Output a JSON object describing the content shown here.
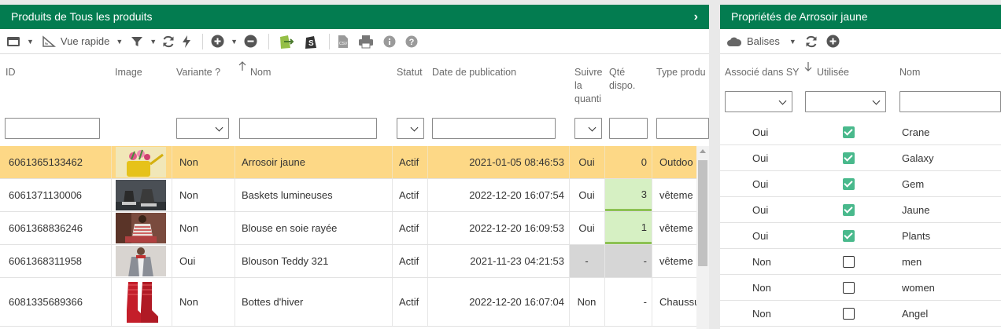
{
  "left": {
    "title": "Produits de Tous les produits",
    "toolbar": {
      "quick_view": "Vue rapide"
    },
    "columns": {
      "id": "ID",
      "image": "Image",
      "variant": "Variante ?",
      "name": "Nom",
      "status": "Statut",
      "pub_date": "Date de publication",
      "track_qty": "Suivre\nla\nquanti",
      "qty": "Qté\ndispo.",
      "type": "Type produ"
    },
    "rows": [
      {
        "id": "6061365133462",
        "variant": "Non",
        "name": "Arrosoir jaune",
        "status": "Actif",
        "date": "2021-01-05 08:46:53",
        "track": "Oui",
        "qty": "0",
        "type": "Outdoo",
        "image": "watering-can-flowers",
        "selected": true
      },
      {
        "id": "6061371130006",
        "variant": "Non",
        "name": "Baskets lumineuses",
        "status": "Actif",
        "date": "2022-12-20 16:07:54",
        "track": "Oui",
        "qty": "3",
        "type": "vêteme",
        "image": "sneakers"
      },
      {
        "id": "6061368836246",
        "variant": "Non",
        "name": "Blouse en soie rayée",
        "status": "Actif",
        "date": "2022-12-20 16:09:53",
        "track": "Oui",
        "qty": "1",
        "type": "vêteme",
        "image": "striped-blouse"
      },
      {
        "id": "6061368311958",
        "variant": "Oui",
        "name": "Blouson Teddy 321",
        "status": "Actif",
        "date": "2021-11-23 04:21:53",
        "track": "-",
        "qty": "-",
        "type": "vêteme",
        "image": "teddy-jacket"
      },
      {
        "id": "6081335689366",
        "variant": "Non",
        "name": "Bottes d'hiver",
        "status": "Actif",
        "date": "2022-12-20 16:07:04",
        "track": "Non",
        "qty": "-",
        "type": "Chaussu",
        "image": "winter-boots"
      }
    ]
  },
  "right": {
    "title": "Propriétés de Arrosoir jaune",
    "toolbar": {
      "tags": "Balises"
    },
    "columns": {
      "assoc": "Associé dans SY",
      "used": "Utilisée",
      "name": "Nom"
    },
    "rows": [
      {
        "assoc": "Oui",
        "used": true,
        "name": "Crane"
      },
      {
        "assoc": "Oui",
        "used": true,
        "name": "Galaxy"
      },
      {
        "assoc": "Oui",
        "used": true,
        "name": "Gem"
      },
      {
        "assoc": "Oui",
        "used": true,
        "name": "Jaune"
      },
      {
        "assoc": "Oui",
        "used": true,
        "name": "Plants"
      },
      {
        "assoc": "Non",
        "used": false,
        "name": "men"
      },
      {
        "assoc": "Non",
        "used": false,
        "name": "women"
      },
      {
        "assoc": "Non",
        "used": false,
        "name": "Angel"
      }
    ]
  },
  "colors": {
    "header": "#037c50",
    "selected_row": "#fdd886",
    "qty_ok": "#d6f0c3",
    "check_on": "#49b98c"
  }
}
